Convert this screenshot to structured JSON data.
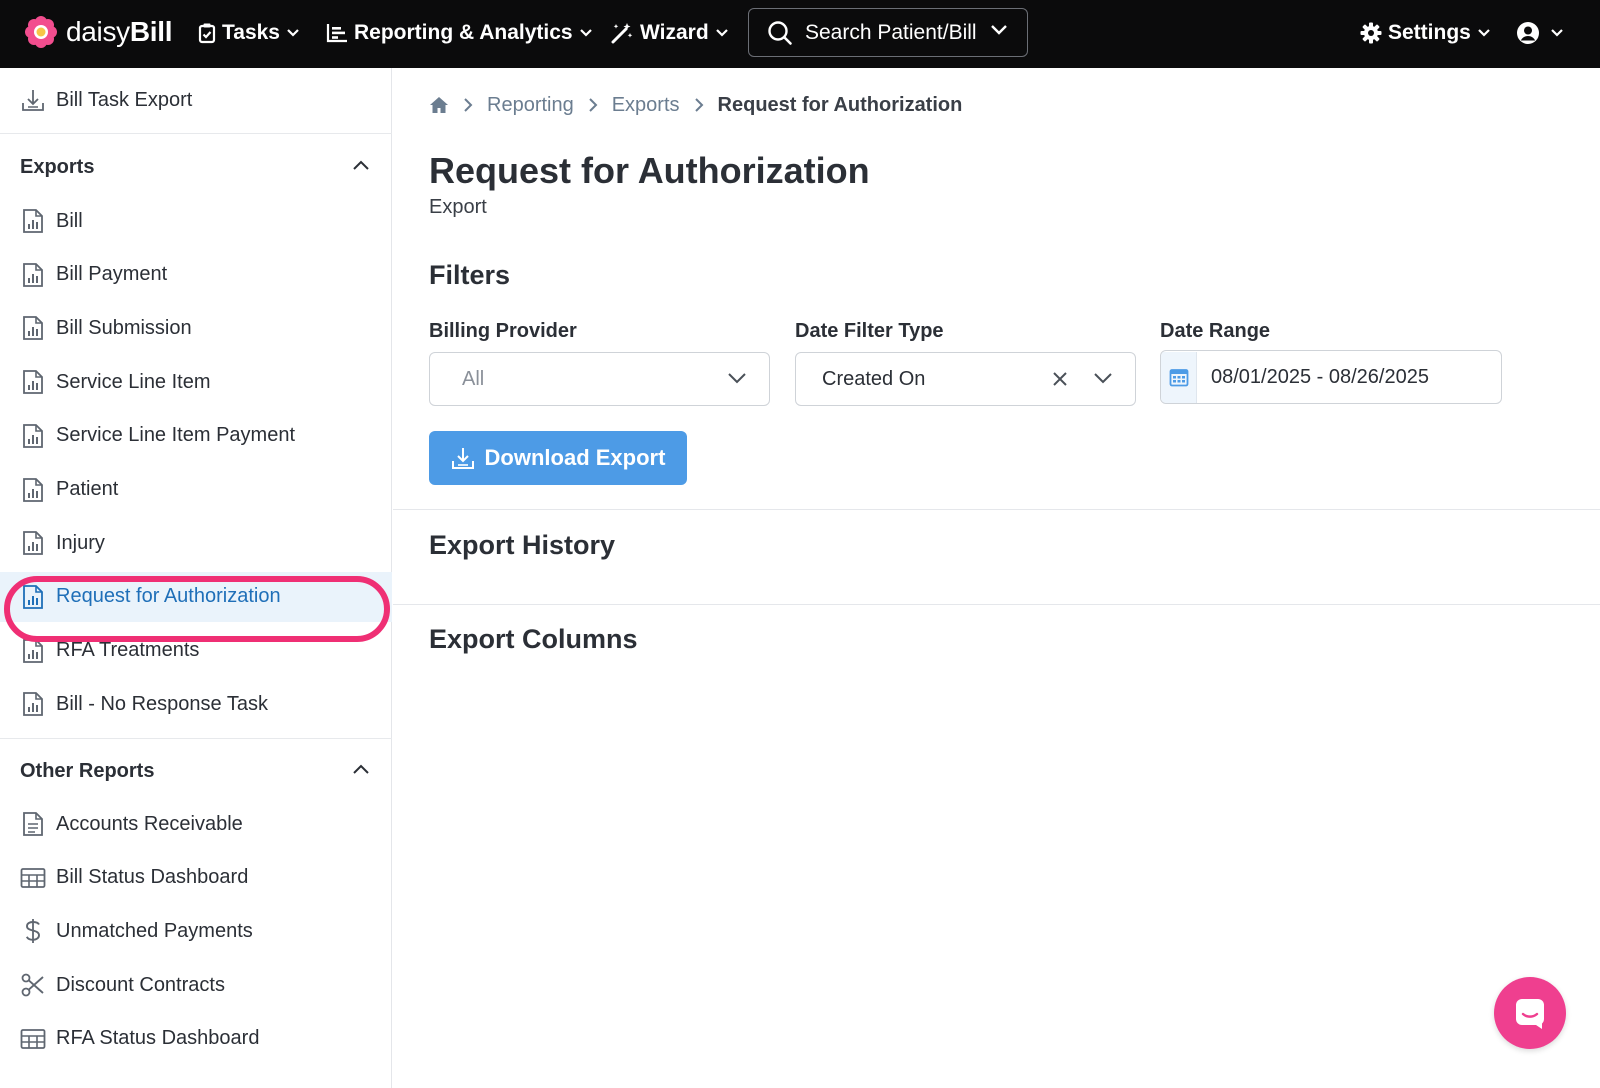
{
  "brand": {
    "name_light": "daisy",
    "name_bold": "Bill"
  },
  "nav": {
    "tasks": "Tasks",
    "reporting": "Reporting & Analytics",
    "wizard": "Wizard",
    "search_placeholder": "Search Patient/Bill",
    "settings": "Settings"
  },
  "sidebar": {
    "top_item": {
      "label": "Bill Task Export",
      "icon": "download-icon"
    },
    "exports_section": "Exports",
    "exports": [
      {
        "label": "Bill",
        "icon": "report-file-icon"
      },
      {
        "label": "Bill Payment",
        "icon": "report-file-icon"
      },
      {
        "label": "Bill Submission",
        "icon": "report-file-icon"
      },
      {
        "label": "Service Line Item",
        "icon": "report-file-icon"
      },
      {
        "label": "Service Line Item Payment",
        "icon": "report-file-icon"
      },
      {
        "label": "Patient",
        "icon": "report-file-icon"
      },
      {
        "label": "Injury",
        "icon": "report-file-icon"
      },
      {
        "label": "Request for Authorization",
        "icon": "report-file-icon",
        "active": true
      },
      {
        "label": "RFA Treatments",
        "icon": "report-file-icon"
      },
      {
        "label": "Bill - No Response Task",
        "icon": "report-file-icon"
      }
    ],
    "other_section": "Other Reports",
    "other": [
      {
        "label": "Accounts Receivable",
        "icon": "document-icon"
      },
      {
        "label": "Bill Status Dashboard",
        "icon": "table-icon"
      },
      {
        "label": "Unmatched Payments",
        "icon": "dollar-icon"
      },
      {
        "label": "Discount Contracts",
        "icon": "scissors-icon"
      },
      {
        "label": "RFA Status Dashboard",
        "icon": "table-icon"
      }
    ]
  },
  "breadcrumb": {
    "level1": "Reporting",
    "level2": "Exports",
    "current": "Request for Authorization"
  },
  "page": {
    "title": "Request for Authorization",
    "subtitle": "Export"
  },
  "filters": {
    "title": "Filters",
    "billing_provider": {
      "label": "Billing Provider",
      "value": "All"
    },
    "date_filter_type": {
      "label": "Date Filter Type",
      "value": "Created On"
    },
    "date_range": {
      "label": "Date Range",
      "value": "08/01/2025 - 08/26/2025"
    },
    "download_button": "Download Export"
  },
  "sections": {
    "history": "Export History",
    "columns": "Export Columns"
  },
  "colors": {
    "accent": "#4d9be6",
    "active_text": "#1f6fb8",
    "highlight": "#ef2f74",
    "chat": "#ef3f8f",
    "topbar": "#0b0b0c"
  }
}
